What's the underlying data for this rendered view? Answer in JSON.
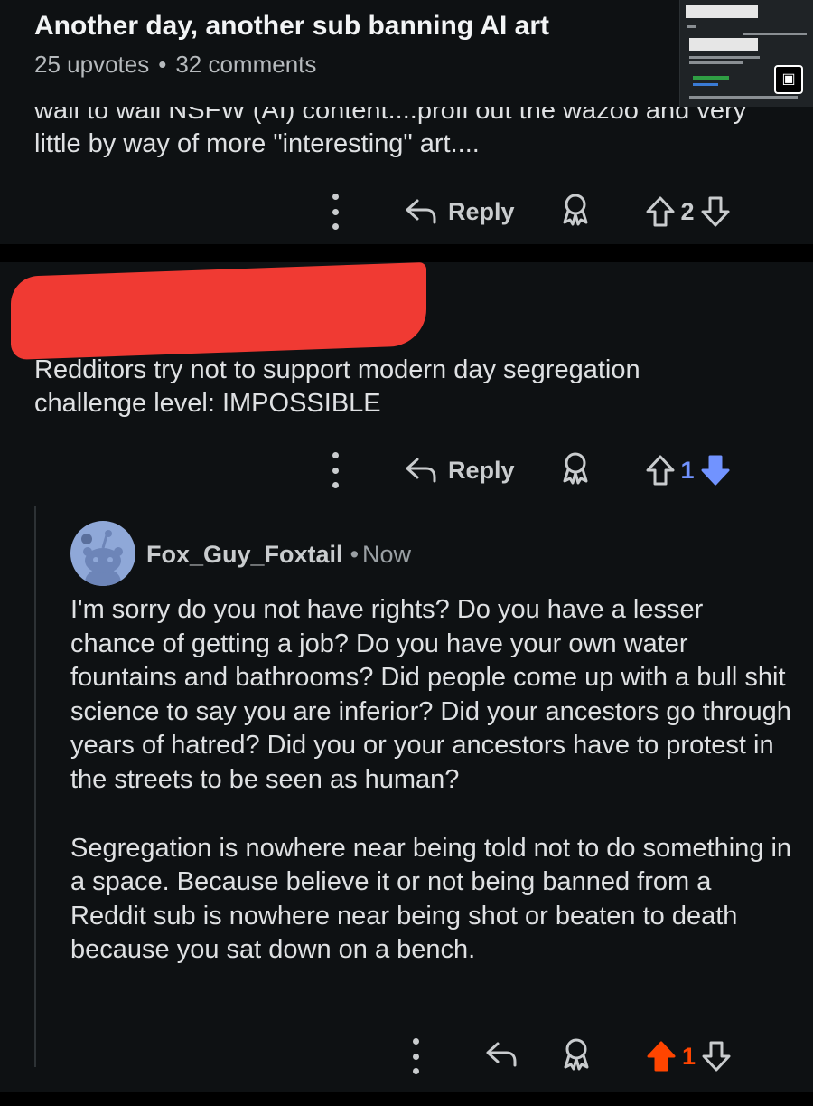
{
  "post": {
    "title": "Another day, another sub banning AI art",
    "upvotes": "25 upvotes",
    "separator": "•",
    "comments": "32 comments"
  },
  "comment1": {
    "text_partial": "wall to wall NSFW (AI) content....profi out the wazoo and very little by way of more \"interesting\" art....",
    "reply_label": "Reply",
    "score": "2"
  },
  "comment2": {
    "text": "Redditors try not to support modern day segregation challenge level: IMPOSSIBLE",
    "reply_label": "Reply",
    "score": "1",
    "downvote_color": "#7193ff"
  },
  "reply": {
    "author": "Fox_Guy_Foxtail",
    "separator": "•",
    "time": "Now",
    "paragraph1": "I'm sorry do you not have rights? Do you have a lesser chance of getting a job? Do you have your own water fountains and bathrooms? Did people come up with a bull shit science to say you are inferior? Did your ancestors go through years of hatred? Did you or your ancestors have to protest in the streets to be seen as human?",
    "paragraph2": "Segregation is nowhere near being told not to do something in a space. Because believe it or not being banned from a Reddit sub is nowhere near being shot or beaten to death because you sat down on a bench.",
    "score": "1",
    "upvote_color": "#ff4500"
  },
  "icons": [
    "more-icon",
    "reply-icon",
    "award-icon",
    "upvote-icon",
    "downvote-icon",
    "image-icon",
    "avatar-snoo"
  ]
}
